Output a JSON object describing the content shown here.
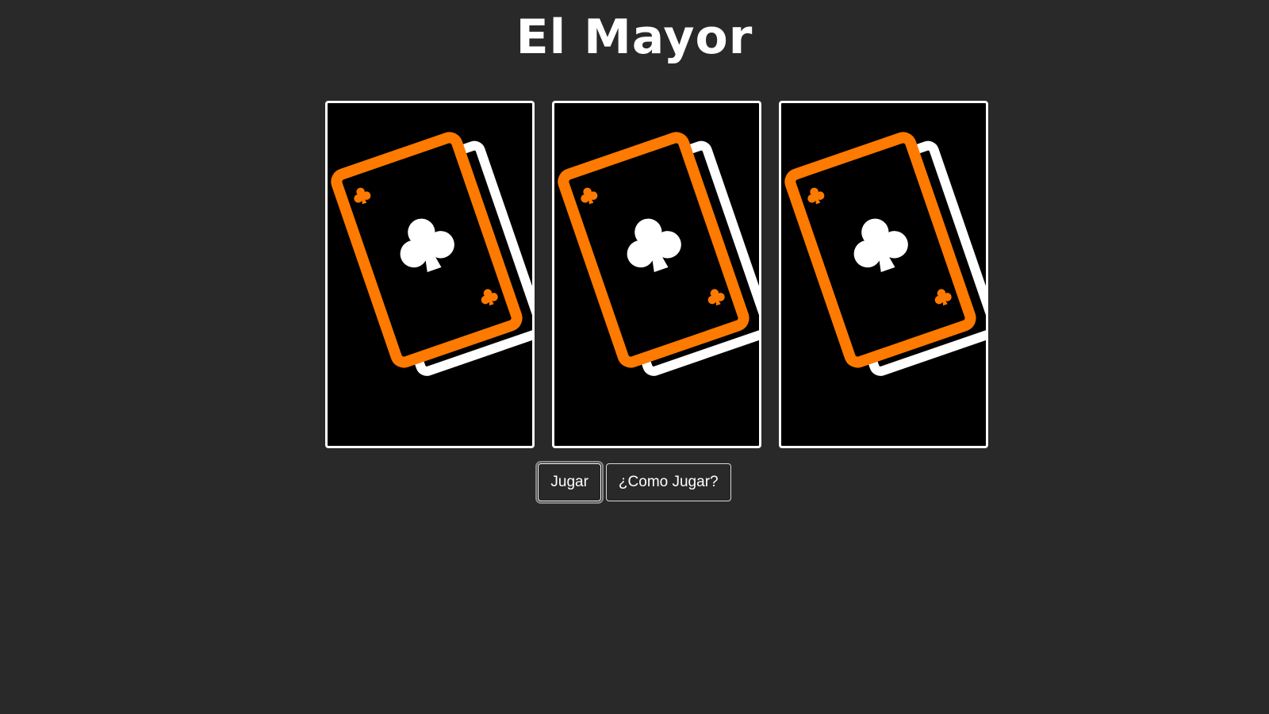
{
  "title": "El Mayor",
  "cards": [
    {
      "name": "card-back",
      "face": "clubs-card-back-icon"
    },
    {
      "name": "card-back",
      "face": "clubs-card-back-icon"
    },
    {
      "name": "card-back",
      "face": "clubs-card-back-icon"
    }
  ],
  "buttons": {
    "play_label": "Jugar",
    "how_to_play_label": "¿Como Jugar?"
  },
  "colors": {
    "background": "#292929",
    "card_background": "#000000",
    "card_accent": "#ff7a00",
    "card_border": "#ffffff"
  }
}
